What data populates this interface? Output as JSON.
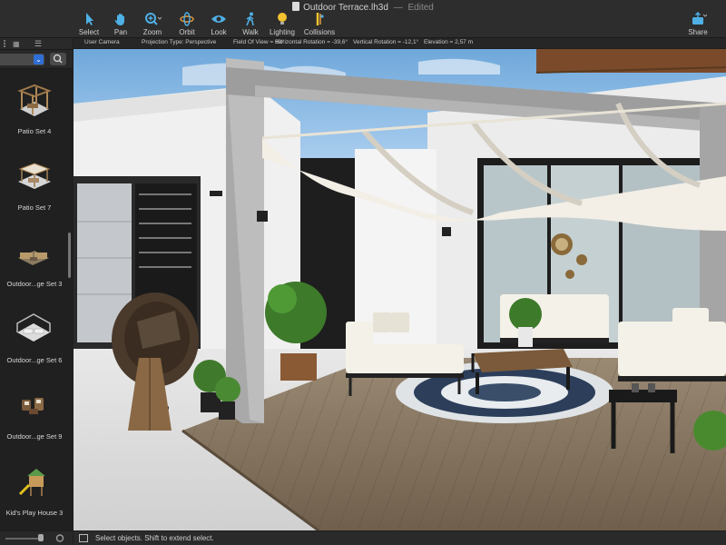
{
  "window": {
    "title": "Outdoor Terrace.lh3d",
    "separator": "—",
    "status": "Edited"
  },
  "toolbar": {
    "tools": [
      {
        "label": "Select"
      },
      {
        "label": "Pan"
      },
      {
        "label": "Zoom"
      },
      {
        "label": "Orbit"
      },
      {
        "label": "Look"
      },
      {
        "label": "Walk"
      },
      {
        "label": "Lighting"
      },
      {
        "label": "Collisions"
      }
    ],
    "share_label": "Share",
    "selected_tool": "Select"
  },
  "infobar": {
    "camera": "User Camera",
    "projection": "Projection Type: Perspective",
    "fov": "Field Of View = 60°",
    "hrot": "Horizontal Rotation = -39,6°",
    "vrot": "Vertical Rotation = -12,1°",
    "elev": "Elevation = 2,57 m"
  },
  "library": {
    "items": [
      {
        "label": "Patio Set 4"
      },
      {
        "label": "Patio Set 7"
      },
      {
        "label": "Outdoor...ge Set 3"
      },
      {
        "label": "Outdoor...ge Set 6"
      },
      {
        "label": "Outdoor...ge Set 9"
      },
      {
        "label": "Kid's Play House 3"
      }
    ]
  },
  "status": {
    "text": "Select objects. Shift to extend select."
  },
  "colors": {
    "accent": "#2f6ed6",
    "toolbar_icon": "#4fb0e6",
    "sky": "#7fb4e0",
    "deck": "#8c7a63"
  },
  "icons": {
    "select": "arrow-cursor-icon",
    "pan": "hand-icon",
    "zoom": "magnifier-plus-icon",
    "orbit": "orbit-icon",
    "look": "eye-icon",
    "walk": "walking-person-icon",
    "lighting": "lightbulb-icon",
    "collisions": "collision-icon",
    "share": "share-icon"
  }
}
